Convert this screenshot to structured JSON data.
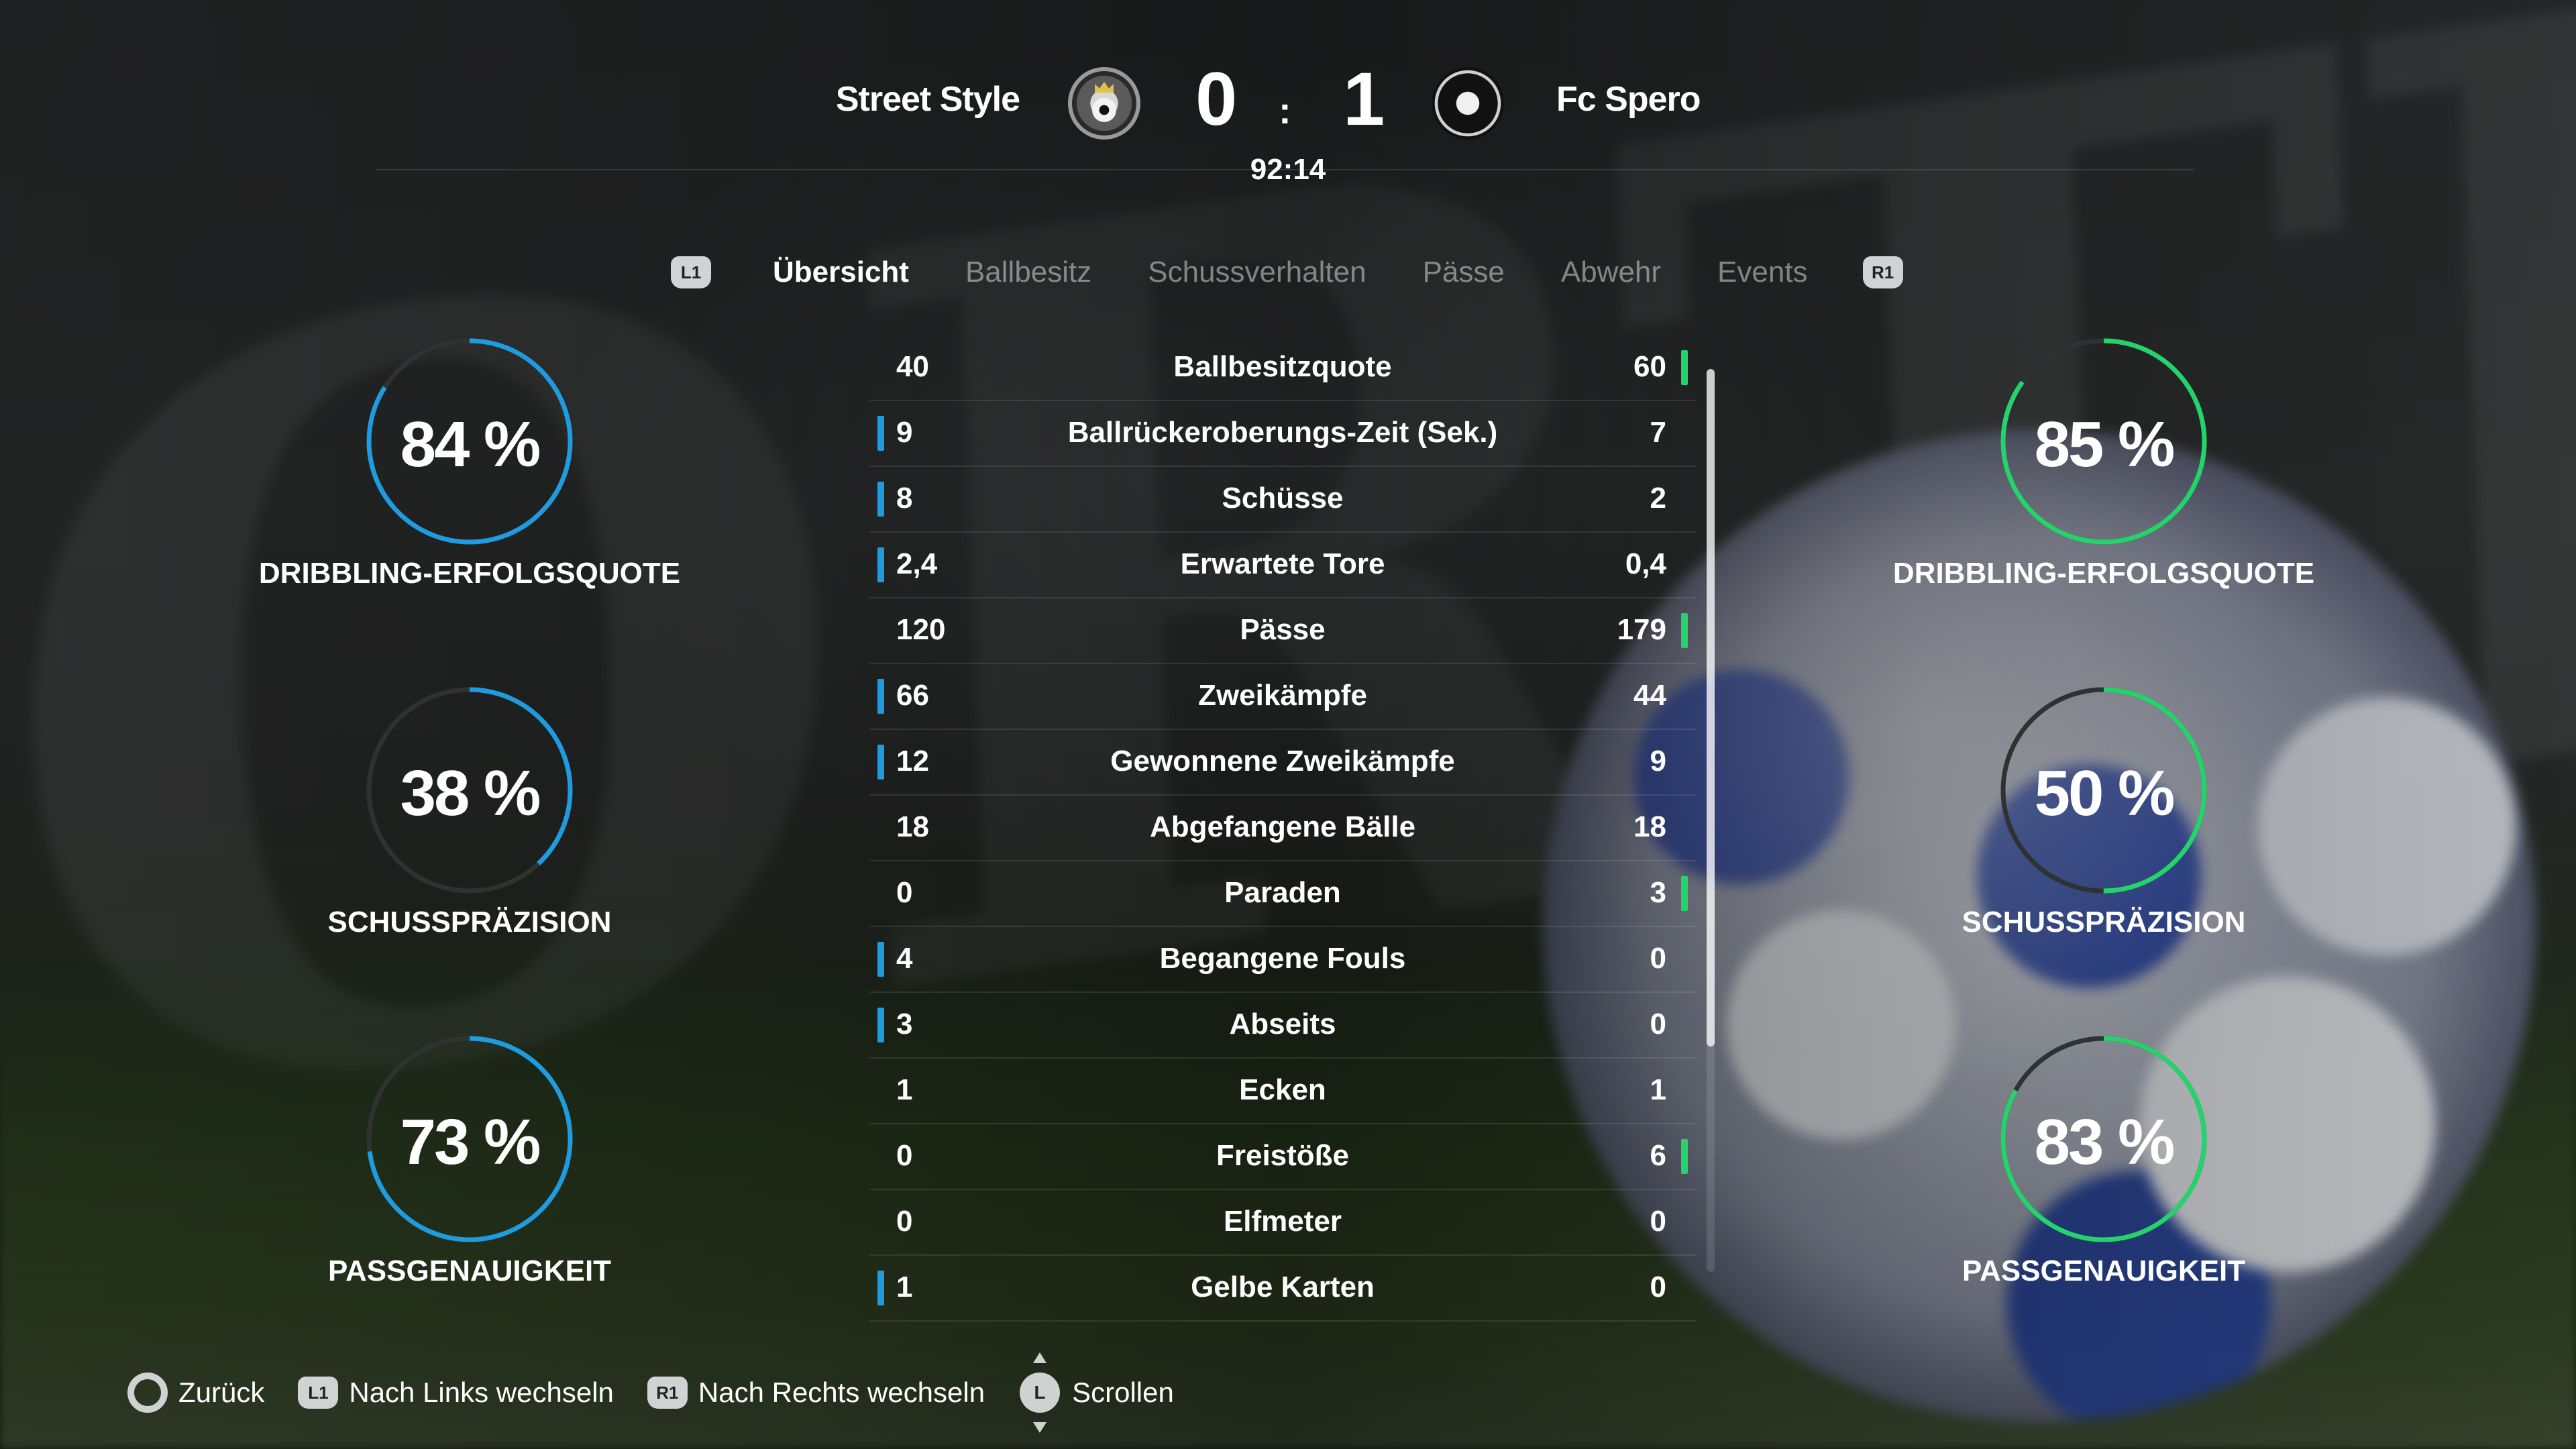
{
  "match": {
    "home_team": "Street Style",
    "away_team": "Fc Spero",
    "home_score": "0",
    "separator": ":",
    "away_score": "1",
    "clock": "92:14"
  },
  "tabs": {
    "left_button": "L1",
    "right_button": "R1",
    "items": [
      {
        "label": "Übersicht",
        "active": true
      },
      {
        "label": "Ballbesitz",
        "active": false
      },
      {
        "label": "Schussverhalten",
        "active": false
      },
      {
        "label": "Pässe",
        "active": false
      },
      {
        "label": "Abwehr",
        "active": false
      },
      {
        "label": "Events",
        "active": false
      }
    ]
  },
  "stats": [
    {
      "label": "Ballbesitzquote",
      "home": "40",
      "away": "60",
      "leader": "away"
    },
    {
      "label": "Ballrückeroberungs-Zeit (Sek.)",
      "home": "9",
      "away": "7",
      "leader": "home"
    },
    {
      "label": "Schüsse",
      "home": "8",
      "away": "2",
      "leader": "home"
    },
    {
      "label": "Erwartete Tore",
      "home": "2,4",
      "away": "0,4",
      "leader": "home"
    },
    {
      "label": "Pässe",
      "home": "120",
      "away": "179",
      "leader": "away"
    },
    {
      "label": "Zweikämpfe",
      "home": "66",
      "away": "44",
      "leader": "home"
    },
    {
      "label": "Gewonnene Zweikämpfe",
      "home": "12",
      "away": "9",
      "leader": "home"
    },
    {
      "label": "Abgefangene Bälle",
      "home": "18",
      "away": "18",
      "leader": "none"
    },
    {
      "label": "Paraden",
      "home": "0",
      "away": "3",
      "leader": "away"
    },
    {
      "label": "Begangene Fouls",
      "home": "4",
      "away": "0",
      "leader": "home"
    },
    {
      "label": "Abseits",
      "home": "3",
      "away": "0",
      "leader": "home"
    },
    {
      "label": "Ecken",
      "home": "1",
      "away": "1",
      "leader": "none"
    },
    {
      "label": "Freistöße",
      "home": "0",
      "away": "6",
      "leader": "away"
    },
    {
      "label": "Elfmeter",
      "home": "0",
      "away": "0",
      "leader": "none"
    },
    {
      "label": "Gelbe Karten",
      "home": "1",
      "away": "0",
      "leader": "home"
    }
  ],
  "gauges": {
    "home": [
      {
        "value": "84 %",
        "fraction": 0.84,
        "label": "DRIBBLING-ERFOLGSQUOTE"
      },
      {
        "value": "38 %",
        "fraction": 0.38,
        "label": "SCHUSSPRÄZISION"
      },
      {
        "value": "73 %",
        "fraction": 0.73,
        "label": "PASSGENAUIGKEIT"
      }
    ],
    "away": [
      {
        "value": "85 %",
        "fraction": 0.85,
        "label": "DRIBBLING-ERFOLGSQUOTE"
      },
      {
        "value": "50 %",
        "fraction": 0.5,
        "label": "SCHUSSPRÄZISION"
      },
      {
        "value": "83 %",
        "fraction": 0.83,
        "label": "PASSGENAUIGKEIT"
      }
    ]
  },
  "footer": {
    "back": "Zurück",
    "left_btn": "L1",
    "left": "Nach Links wechseln",
    "right_btn": "R1",
    "right": "Nach Rechts wechseln",
    "stick": "L",
    "scroll": "Scrollen"
  },
  "colors": {
    "home_accent": "#1f9bdf",
    "away_accent": "#25d36b",
    "gauge_track": "#2f3233"
  },
  "scroll": {
    "visible_fraction": 0.75
  }
}
